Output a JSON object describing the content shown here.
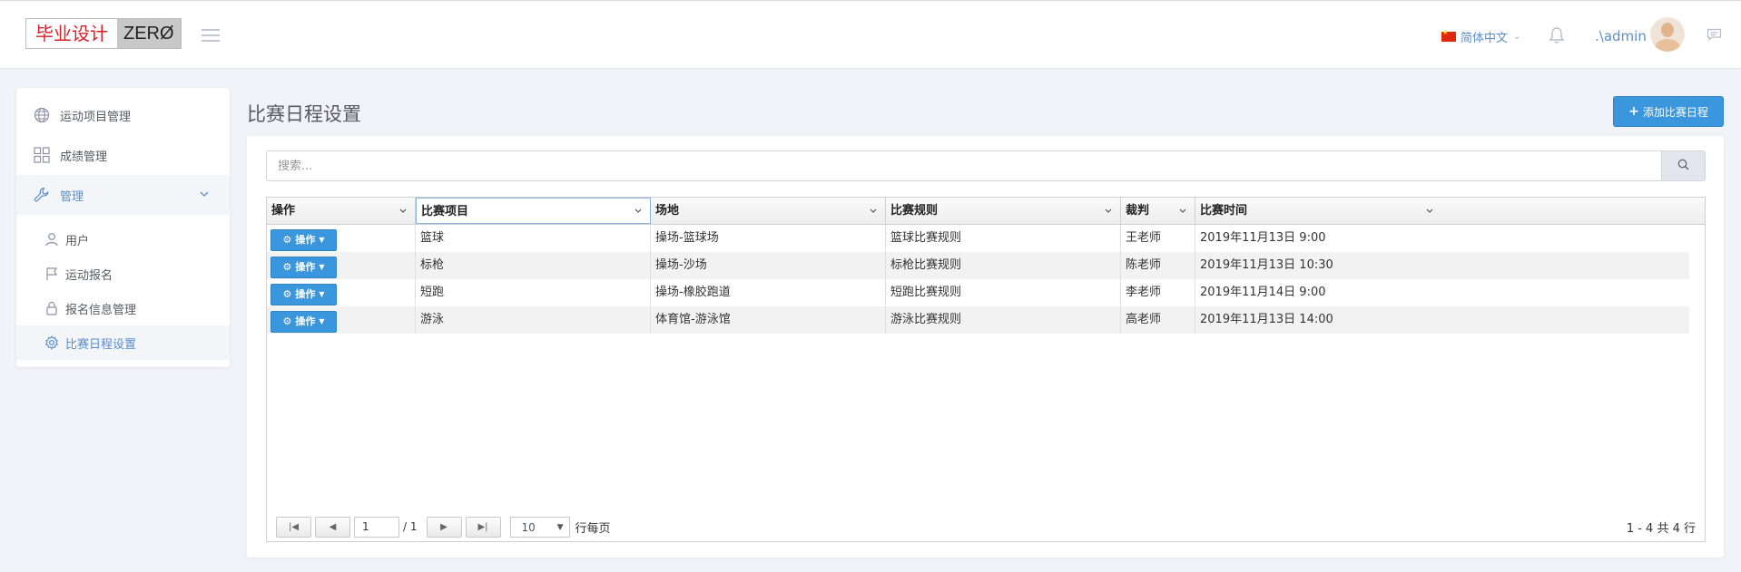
{
  "header": {
    "logo_cn": "毕业设计",
    "logo_en": "ZERØ",
    "language": "简体中文",
    "username": ".\\admin"
  },
  "sidebar": {
    "items": [
      {
        "label": "运动项目管理",
        "icon": "globe-icon"
      },
      {
        "label": "成绩管理",
        "icon": "grid-icon"
      },
      {
        "label": "管理",
        "icon": "wrench-icon"
      }
    ],
    "subitems": [
      {
        "label": "用户",
        "icon": "user-icon"
      },
      {
        "label": "运动报名",
        "icon": "flag-icon"
      },
      {
        "label": "报名信息管理",
        "icon": "lock-icon"
      },
      {
        "label": "比赛日程设置",
        "icon": "gear-icon"
      }
    ]
  },
  "main": {
    "title": "比赛日程设置",
    "add_button": "添加比赛日程",
    "search_placeholder": "搜索..."
  },
  "table": {
    "columns": [
      "操作",
      "比赛项目",
      "场地",
      "比赛规则",
      "裁判",
      "比赛时间"
    ],
    "action_label": "操作",
    "rows": [
      [
        "篮球",
        "操场-篮球场",
        "篮球比赛规则",
        "王老师",
        "2019年11月13日 9:00"
      ],
      [
        "标枪",
        "操场-沙场",
        "标枪比赛规则",
        "陈老师",
        "2019年11月13日 10:30"
      ],
      [
        "短跑",
        "操场-橡胶跑道",
        "短跑比赛规则",
        "李老师",
        "2019年11月14日 9:00"
      ],
      [
        "游泳",
        "体育馆-游泳馆",
        "游泳比赛规则",
        "高老师",
        "2019年11月13日 14:00"
      ]
    ]
  },
  "pager": {
    "page": "1",
    "total_pages": "/ 1",
    "page_size": "10",
    "per_page_label": "行每页",
    "summary": "1 - 4 共 4 行"
  },
  "colors": {
    "accent": "#3a96dd",
    "link": "#5c8ecb"
  }
}
